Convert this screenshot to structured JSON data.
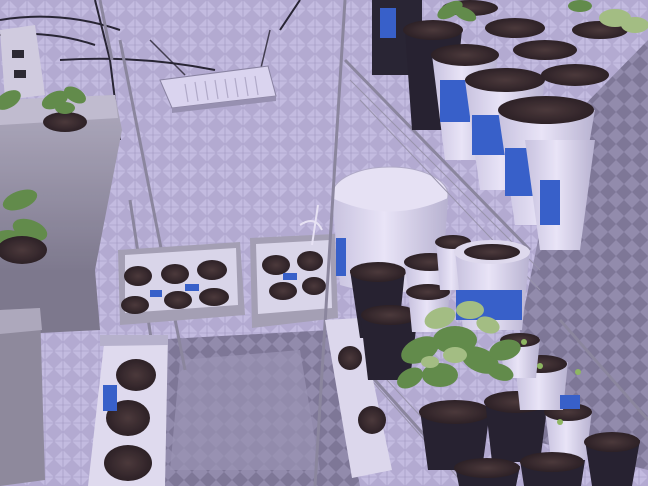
{
  "scene": {
    "palette": {
      "mylar_light": "#d9d6e8",
      "mylar_mid": "#a9a6bd",
      "mylar_dark": "#6e6b80",
      "shelf_wire": "#8c8a98",
      "bucket_white": "#eceaf4",
      "tape_blue": "#2f5fc8",
      "soil": "#2d2119",
      "leaf_green": "#5e8f3c",
      "leaf_light": "#a6c77a",
      "grow_light": "#dcd8ec",
      "tote_gray": "#8f8d96"
    }
  }
}
